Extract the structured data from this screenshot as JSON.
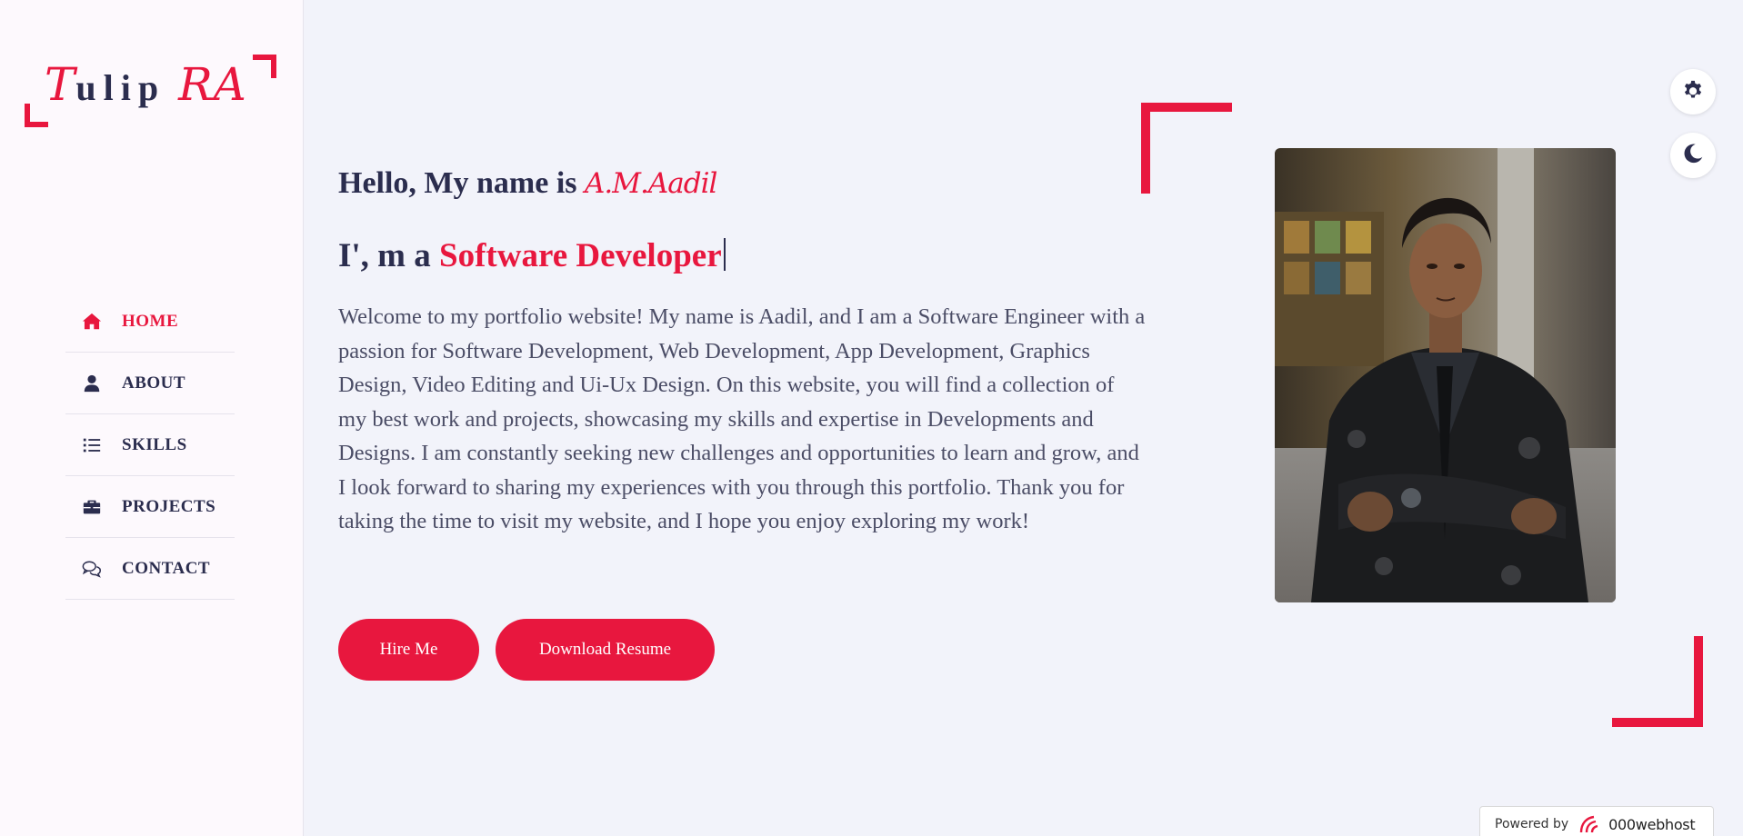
{
  "logo": {
    "part1": "T",
    "part2": "ulip",
    "part3": "RA"
  },
  "nav": [
    {
      "label": "HOME",
      "icon": "home-icon",
      "active": true
    },
    {
      "label": "ABOUT",
      "icon": "user-icon",
      "active": false
    },
    {
      "label": "SKILLS",
      "icon": "list-icon",
      "active": false
    },
    {
      "label": "PROJECTS",
      "icon": "briefcase-icon",
      "active": false
    },
    {
      "label": "CONTACT",
      "icon": "chat-icon",
      "active": false
    }
  ],
  "hero": {
    "greeting_prefix": "Hello, My name is ",
    "greeting_name": "A.M.Aadil",
    "role_prefix": "I', m a ",
    "role_highlight": "Software Developer",
    "intro": "Welcome to my portfolio website! My name is Aadil, and I am a Software Engineer with a passion for Software Development, Web Development, App Development, Graphics Design, Video Editing and Ui-Ux Design. On this website, you will find a collection of my best work and projects, showcasing my skills and expertise in Developments and Designs. I am constantly seeking new challenges and opportunities to learn and grow, and I look forward to sharing my experiences with you through this portfolio. Thank you for taking the time to visit my website, and I hope you enjoy exploring my work!",
    "hire_label": "Hire Me",
    "resume_label": "Download Resume"
  },
  "floating": {
    "settings_icon": "gear-icon",
    "theme_icon": "moon-icon"
  },
  "footer": {
    "powered_by": "Powered by",
    "brand": "000webhost"
  },
  "colors": {
    "accent": "#e8173e",
    "text": "#2b2d4e",
    "background": "#f2f3fa",
    "sidebar": "#fdf9fd"
  }
}
